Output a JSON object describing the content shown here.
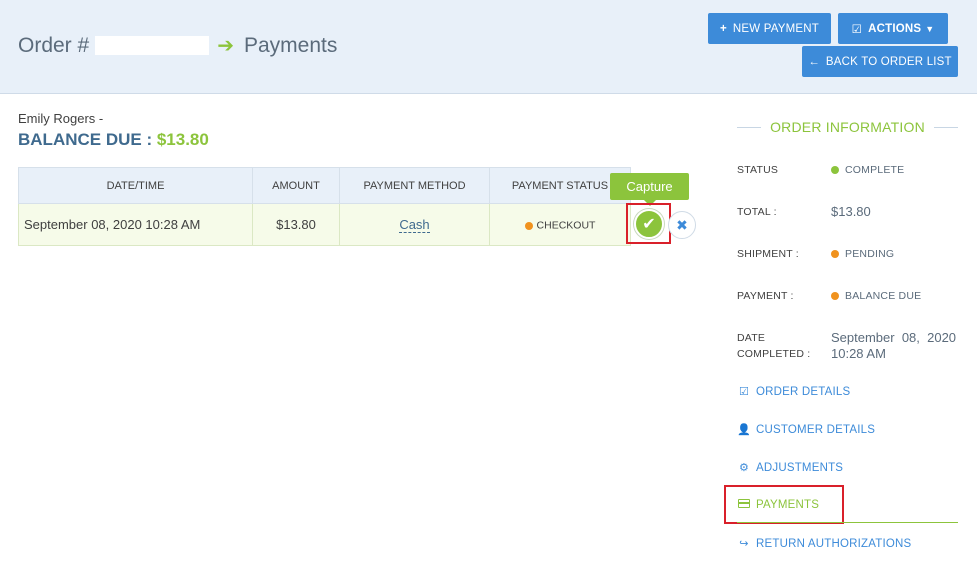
{
  "header": {
    "order_label": "Order #",
    "page_title": "Payments",
    "new_payment_label": "NEW PAYMENT",
    "actions_label": "ACTIONS",
    "back_label": "BACK TO ORDER LIST"
  },
  "customer": {
    "name": "Emily Rogers -",
    "balance_label": "BALANCE DUE :",
    "balance_amount": "$13.80"
  },
  "payments_table": {
    "columns": [
      "DATE/TIME",
      "AMOUNT",
      "PAYMENT METHOD",
      "PAYMENT STATUS"
    ],
    "rows": [
      {
        "datetime": "September 08, 2020 10:28 AM",
        "amount": "$13.80",
        "method": "Cash",
        "status": "CHECKOUT"
      }
    ],
    "capture_tooltip": "Capture"
  },
  "sidebar": {
    "heading": "ORDER INFORMATION",
    "status_label": "STATUS",
    "status_value": "COMPLETE",
    "total_label": "TOTAL :",
    "total_value": "$13.80",
    "shipment_label": "SHIPMENT :",
    "shipment_value": "PENDING",
    "payment_label": "PAYMENT :",
    "payment_value": "BALANCE DUE",
    "date_completed_label_1": "DATE",
    "date_completed_label_2": "COMPLETED :",
    "date_completed_value_1": "September  08,  2020",
    "date_completed_value_2": "10:28 AM",
    "links": {
      "order_details": "ORDER DETAILS",
      "customer_details": "CUSTOMER DETAILS",
      "adjustments": "ADJUSTMENTS",
      "payments": "PAYMENTS",
      "return_authorizations": "RETURN AUTHORIZATIONS"
    }
  },
  "colors": {
    "accent_green": "#8cc43c",
    "button_blue": "#3d8bd9",
    "status_orange": "#f0921e",
    "highlight_red": "#d9202a",
    "header_bg": "#e8f0f9"
  },
  "icons": {
    "title_arrow": "arrow-right-icon",
    "new_payment": "plus-icon",
    "actions": "edit-square-icon",
    "back": "arrow-left-icon",
    "capture": "check-icon",
    "void": "x-icon",
    "order_details": "edit-square-icon",
    "customer_details": "user-icon",
    "adjustments": "cogs-icon",
    "payments": "credit-card-icon",
    "return_authorizations": "share-arrow-icon"
  }
}
